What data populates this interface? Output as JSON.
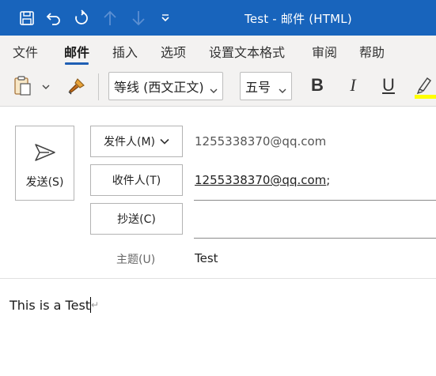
{
  "window": {
    "title": "Test  -  邮件 (HTML)"
  },
  "quick_access": {
    "icons": [
      "save-icon",
      "undo-icon",
      "redo-icon",
      "up-arrow-icon",
      "down-arrow-icon",
      "customize-dropdown-icon"
    ]
  },
  "ribbon": {
    "tabs": [
      {
        "label": "文件",
        "active": false
      },
      {
        "label": "邮件",
        "active": true
      },
      {
        "label": "插入",
        "active": false
      },
      {
        "label": "选项",
        "active": false
      },
      {
        "label": "设置文本格式",
        "active": false
      },
      {
        "label": "审阅",
        "active": false
      },
      {
        "label": "帮助",
        "active": false
      }
    ],
    "font_name": "等线 (西文正文)",
    "font_size": "五号",
    "bold_label": "B",
    "italic_label": "I",
    "underline_label": "U",
    "highlight_color": "#ffff00"
  },
  "compose": {
    "send_label": "发送(S)",
    "from_button": "发件人(M)",
    "to_button": "收件人(T)",
    "cc_button": "抄送(C)",
    "subject_label": "主题(U)",
    "from_value": "1255338370@qq.com",
    "to_value": "1255338370@qq.com",
    "to_separator": ";",
    "cc_value": "",
    "subject_value": "Test",
    "body_text": "This is a Test"
  },
  "colors": {
    "titlebar": "#1864bc",
    "accent": "#1f5fb4",
    "ribbon_bg": "#f3f2f1"
  }
}
